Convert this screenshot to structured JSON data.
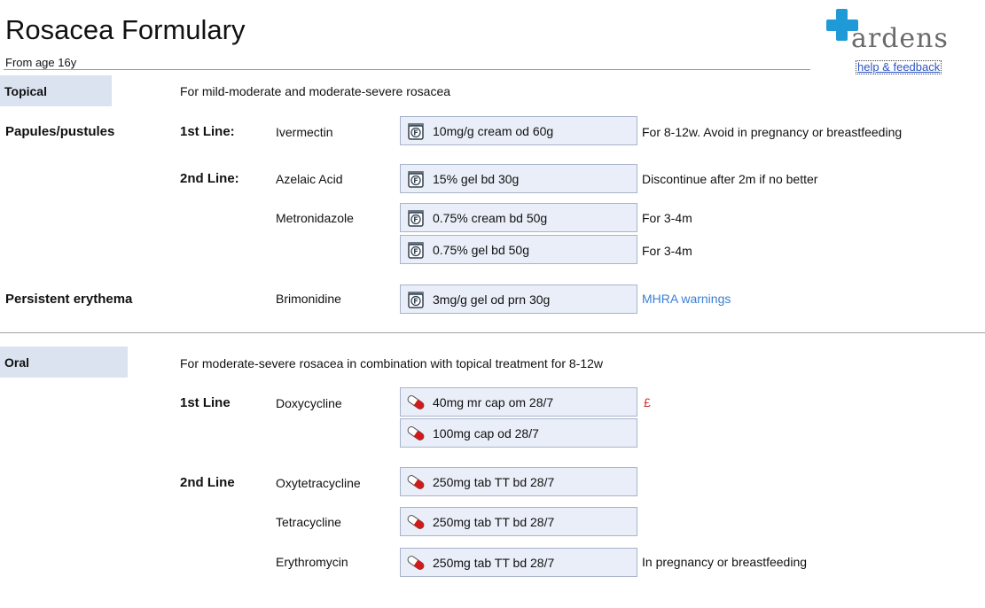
{
  "header": {
    "title": "Rosacea Formulary",
    "subtitle": "From age 16y",
    "logo_text": "ardens",
    "help_link": "help & feedback"
  },
  "topical": {
    "tab": "Topical",
    "description": "For mild-moderate and moderate-severe rosacea",
    "papules": {
      "label": "Papules/pustules",
      "first_line_label": "1st Line:",
      "second_line_label": "2nd Line:",
      "ivermectin": {
        "drug": "Ivermectin",
        "rx": "10mg/g cream od 60g",
        "note": "For 8-12w. Avoid in pregnancy or breastfeeding"
      },
      "azelaic": {
        "drug": "Azelaic Acid",
        "rx": "15% gel bd 30g",
        "note": "Discontinue after 2m if no better"
      },
      "metronidazole": {
        "drug": "Metronidazole",
        "rx_cream": "0.75% cream bd 50g",
        "note_cream": "For 3-4m",
        "rx_gel": "0.75% gel bd 50g",
        "note_gel": "For 3-4m"
      }
    },
    "erythema": {
      "label": "Persistent erythema",
      "brimonidine": {
        "drug": "Brimonidine",
        "rx": "3mg/g gel od prn 30g",
        "link": "MHRA warnings"
      }
    }
  },
  "oral": {
    "tab": "Oral",
    "description": "For moderate-severe rosacea in combination with topical treatment for 8-12w",
    "first_line_label": "1st Line",
    "second_line_label": "2nd Line",
    "doxycycline": {
      "drug": "Doxycycline",
      "rx_mr": "40mg mr cap om 28/7",
      "price_flag": "£",
      "rx_std": "100mg cap od 28/7"
    },
    "oxytetracycline": {
      "drug": "Oxytetracycline",
      "rx": "250mg tab TT bd 28/7"
    },
    "tetracycline": {
      "drug": "Tetracycline",
      "rx": "250mg tab TT bd 28/7"
    },
    "erythromycin": {
      "drug": "Erythromycin",
      "rx": "250mg tab TT bd 28/7",
      "note": "In pregnancy or breastfeeding"
    }
  },
  "icons": {
    "topical": "formulary-jar-icon",
    "oral": "capsule-icon"
  },
  "colors": {
    "tab_bg": "#dbe3f0",
    "rx_bg": "#e9eef8",
    "logo_blue": "#1f9ad6",
    "link": "#3a7fd5",
    "pound": "#d03030"
  }
}
